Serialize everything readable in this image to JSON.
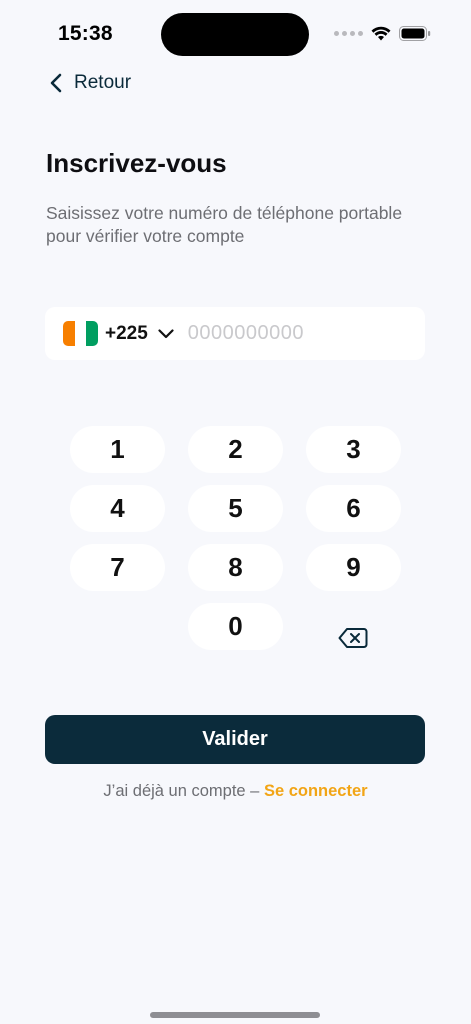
{
  "status_bar": {
    "time": "15:38"
  },
  "nav": {
    "back_label": "Retour"
  },
  "header": {
    "title": "Inscrivez-vous",
    "subtitle": "Saisissez votre numéro de téléphone portable pour vérifier votre compte"
  },
  "phone": {
    "dial_code": "+225",
    "placeholder": "0000000000",
    "value": "",
    "flag_colors": [
      "#f77f00",
      "#ffffff",
      "#009e60"
    ]
  },
  "keypad": {
    "keys": [
      "1",
      "2",
      "3",
      "4",
      "5",
      "6",
      "7",
      "8",
      "9",
      "0"
    ],
    "backspace_icon": "backspace-icon"
  },
  "actions": {
    "submit_label": "Valider",
    "login_prompt": "J’ai déjà un compte –",
    "login_link": "Se connecter"
  },
  "colors": {
    "primary": "#0b2b3b",
    "accent": "#f2a516",
    "background": "#f7f8fc"
  }
}
